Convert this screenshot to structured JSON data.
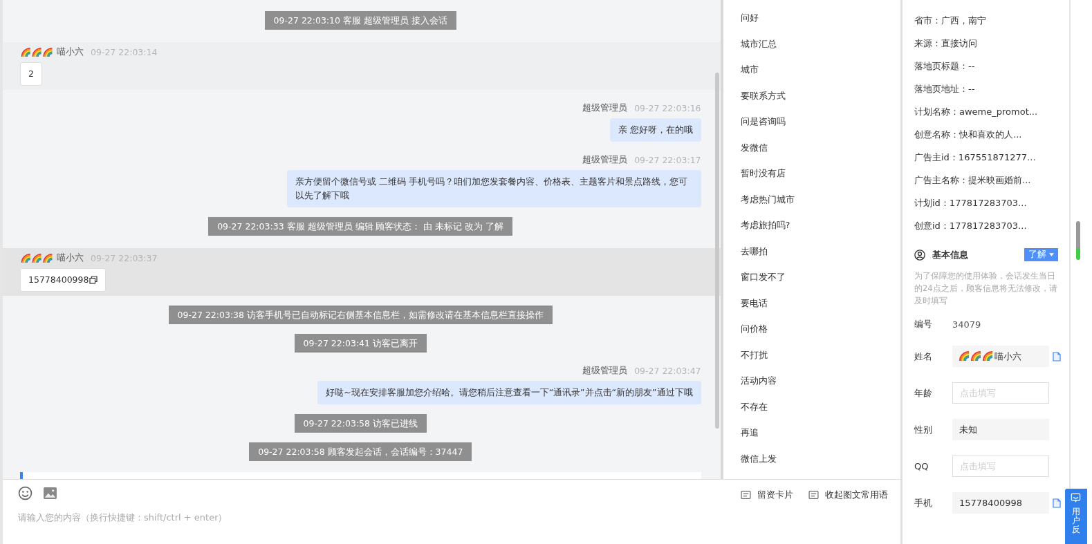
{
  "chat": {
    "messages": [
      {
        "kind": "system",
        "text": "09-27 22:03:10 客服 超级管理员 接入会话"
      },
      {
        "kind": "visitor",
        "sender": "喵小六",
        "decorated": true,
        "time": "09-27 22:03:14",
        "text": "2",
        "copyable": false,
        "selected": false
      },
      {
        "kind": "agent",
        "sender": "超级管理员",
        "time": "09-27 22:03:16",
        "text": "亲 您好呀，在的哦"
      },
      {
        "kind": "agent",
        "sender": "超级管理员",
        "time": "09-27 22:03:17",
        "text": "亲方便留个微信号或 二维码 手机号吗？咱们加您发套餐内容、价格表、主题客片和景点路线，您可以先了解下哦"
      },
      {
        "kind": "system",
        "text": "09-27 22:03:33 客服 超级管理员 编辑 顾客状态： 由 未标记 改为 了解"
      },
      {
        "kind": "visitor",
        "sender": "喵小六",
        "decorated": true,
        "time": "09-27 22:03:37",
        "text": "15778400998",
        "copyable": true,
        "selected": true
      },
      {
        "kind": "system",
        "text": "09-27 22:03:38 访客手机号已自动标记右侧基本信息栏，如需修改请在基本信息栏直接操作"
      },
      {
        "kind": "system",
        "text": "09-27 22:03:41 访客已离开"
      },
      {
        "kind": "agent",
        "sender": "超级管理员",
        "time": "09-27 22:03:47",
        "text": "好哒~现在安排客服加您介绍哈。请您稍后注意查看一下“通讯录”并点击“新的朋友”通过下哦"
      },
      {
        "kind": "system",
        "text": "09-27 22:03:58 访客已进线"
      },
      {
        "kind": "system",
        "text": "09-27 22:03:58 顾客发起会话，会话编号：37447"
      },
      {
        "kind": "card"
      }
    ]
  },
  "phrases": {
    "items": [
      "问好",
      "城市汇总",
      "城市",
      "要联系方式",
      "问是咨询吗",
      "发微信",
      "暂时没有店",
      "考虑热门城市",
      "考虑旅拍吗?",
      "去哪拍",
      "窗口发不了",
      "要电话",
      "问价格",
      "不打扰",
      "活动内容",
      "不存在",
      "再追",
      "微信上发"
    ]
  },
  "composer": {
    "placeholder": "请输入您的内容（换行快捷键：shift/ctrl + enter）",
    "tools": [
      "留资卡片",
      "收起图文常用语"
    ]
  },
  "visitor_info": {
    "fields": [
      "省市：广西，南宁",
      "来源：直接访问",
      "落地页标题：--",
      "落地页地址：--",
      "计划名称：aweme_promot...",
      "创意名称：快和喜欢的人...",
      "广告主id：167551871277...",
      "广告主名称：提米映画婚前...",
      "计划id：177817283703...",
      "创意id：177817283703..."
    ]
  },
  "basic_info": {
    "title": "基本信息",
    "status": "了解",
    "notice": "为了保障您的使用体验，会话发生当日的24点之后，顾客信息将无法修改，请及时填写",
    "rows": [
      {
        "kind": "text",
        "label": "编号",
        "value": "34079"
      },
      {
        "kind": "readonly",
        "label": "姓名",
        "value": "喵小六",
        "decorated": true,
        "copyable": true
      },
      {
        "kind": "input",
        "label": "年龄",
        "placeholder": "点击填写"
      },
      {
        "kind": "readonly",
        "label": "性别",
        "value": "未知",
        "decorated": false,
        "copyable": false
      },
      {
        "kind": "input",
        "label": "QQ",
        "placeholder": "点击填写"
      },
      {
        "kind": "readonly",
        "label": "手机",
        "value": "15778400998",
        "decorated": false,
        "copyable": true
      }
    ]
  },
  "feedback": {
    "label": "用户反"
  }
}
